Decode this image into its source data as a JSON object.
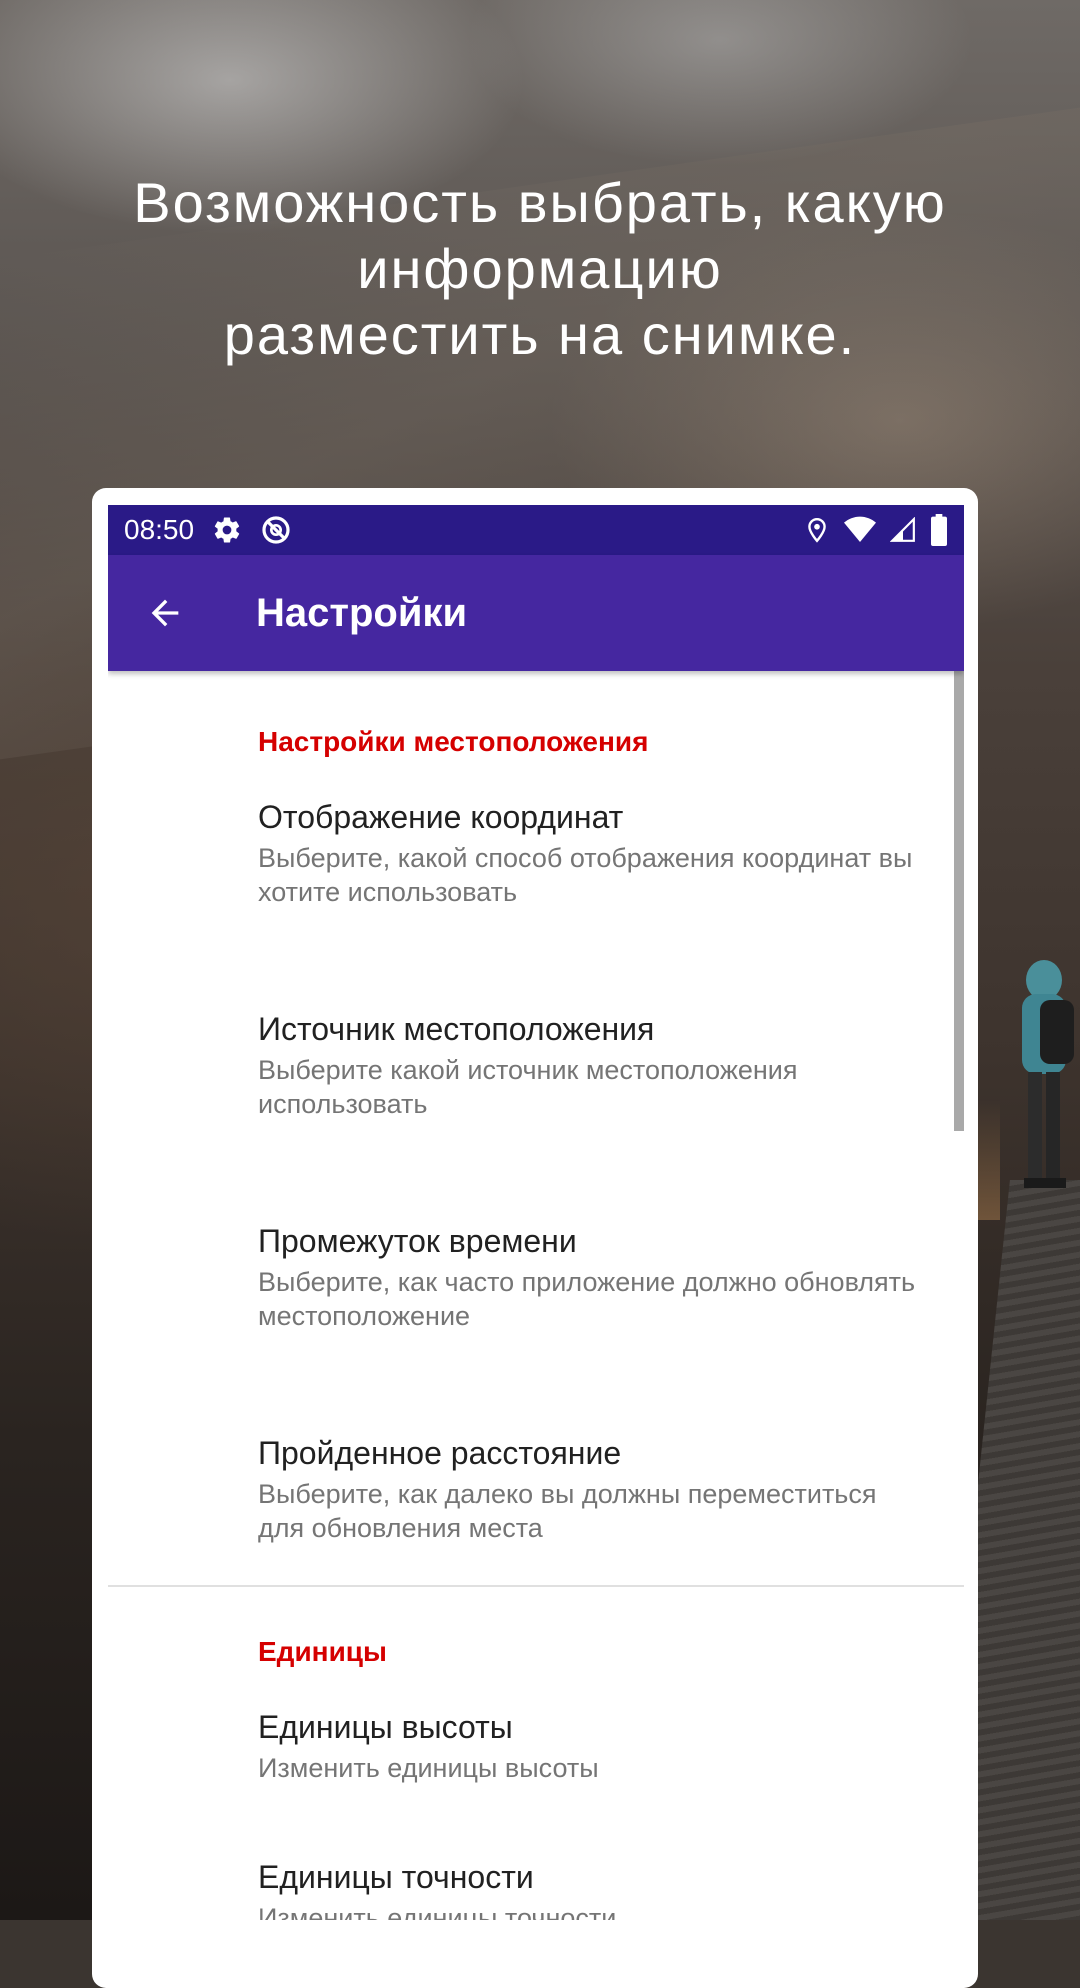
{
  "promo": {
    "headline_line1": "Возможность выбрать, какую",
    "headline_line2": "информацию",
    "headline_line3": "разместить на снимке."
  },
  "status_bar": {
    "time": "08:50",
    "icons_left": [
      "gear-icon",
      "do-not-disturb-icon"
    ],
    "icons_right": [
      "location-icon",
      "wifi-icon",
      "signal-icon",
      "battery-icon"
    ]
  },
  "app_bar": {
    "title": "Настройки",
    "back_icon": "arrow-back-icon",
    "color": "#4527a0",
    "status_color": "#2a1a87"
  },
  "sections": [
    {
      "title": "Настройки местоположения",
      "items": [
        {
          "title": "Отображение координат",
          "summary": "Выберите, какой способ отображения координат вы хотите использовать"
        },
        {
          "title": "Источник местоположения",
          "summary": "Выберите какой источник местоположения использовать"
        },
        {
          "title": "Промежуток времени",
          "summary": "Выберите, как часто приложение должно обновлять местоположение"
        },
        {
          "title": "Пройденное расстояние",
          "summary": "Выберите, как далеко вы должны переместиться для обновления места"
        }
      ]
    },
    {
      "title": "Единицы",
      "items": [
        {
          "title": "Единицы высоты",
          "summary": "Изменить единицы высоты"
        },
        {
          "title": "Единицы точности",
          "summary": "Изменить единицы точности"
        }
      ]
    }
  ],
  "accent_color": "#d50000"
}
